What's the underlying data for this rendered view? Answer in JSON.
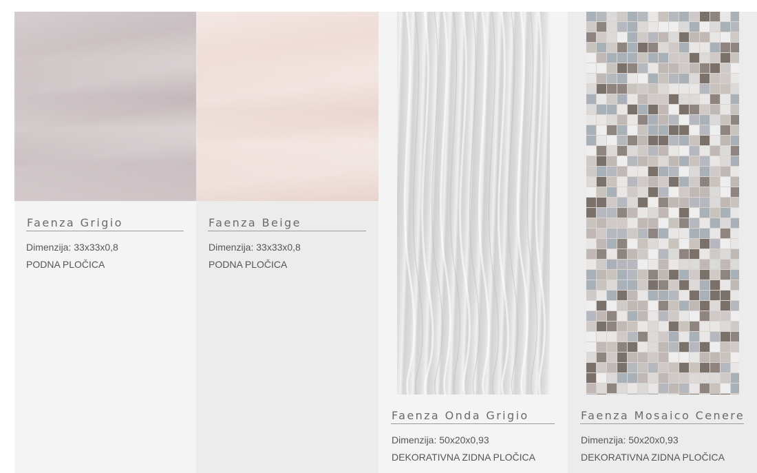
{
  "products": [
    {
      "name": "Faenza Grigio",
      "dimension": "Dimenzija: 33x33x0,8",
      "type": "PODNA PLOČICA",
      "image": "grigio-tile-image",
      "color": "#c7bdc0"
    },
    {
      "name": "Faenza Beige",
      "dimension": "Dimenzija: 33x33x0,8",
      "type": "PODNA PLOČICA",
      "image": "beige-tile-image",
      "color": "#eedcd6"
    },
    {
      "name": "Faenza Onda Grigio",
      "dimension": "Dimenzija: 50x20x0,93",
      "type": "DEKORATIVNA ZIDNA PLOČICA",
      "image": "onda-wave-tile-image",
      "color": "#dedede"
    },
    {
      "name": "Faenza Mosaico Cenere",
      "dimension": "Dimenzija: 50x20x0,93",
      "type": "DEKORATIVNA ZIDNA PLOČICA",
      "image": "mosaic-tile-image",
      "color": "#a79e99"
    }
  ]
}
